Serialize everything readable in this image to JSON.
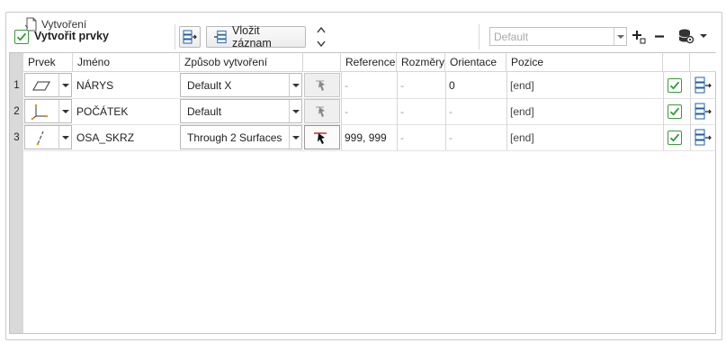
{
  "group": {
    "title": "Vytvoření"
  },
  "toolbar": {
    "create_label": "Vytvořit prvky",
    "insert_label": "Vložit záznam",
    "default_combo": "Default"
  },
  "table": {
    "columns": [
      "Prvek",
      "Jméno",
      "Způsob vytvoření",
      "",
      "Reference",
      "Rozměry",
      "Orientace",
      "Pozice",
      "",
      ""
    ],
    "rows": [
      {
        "num": "1",
        "icon": "plane-icon",
        "name": "NÁRYS",
        "method": "Default X",
        "reference": "-",
        "dimensions": "-",
        "orientation": "0",
        "position": "[end]",
        "checked": true
      },
      {
        "num": "2",
        "icon": "origin-axes-icon",
        "name": "POČÁTEK",
        "method": "Default",
        "reference": "-",
        "dimensions": "-",
        "orientation": "-",
        "position": "[end]",
        "checked": true
      },
      {
        "num": "3",
        "icon": "axis-line-icon",
        "name": "OSA_SKRZ",
        "method": "Through 2 Surfaces",
        "reference": "999, 999",
        "dimensions": "-",
        "orientation": "-",
        "position": "[end]",
        "checked": true
      }
    ]
  },
  "colors": {
    "check_green": "#2e9b2e",
    "accent_blue": "#1f5fa8",
    "red_marker": "#c81e1e"
  }
}
